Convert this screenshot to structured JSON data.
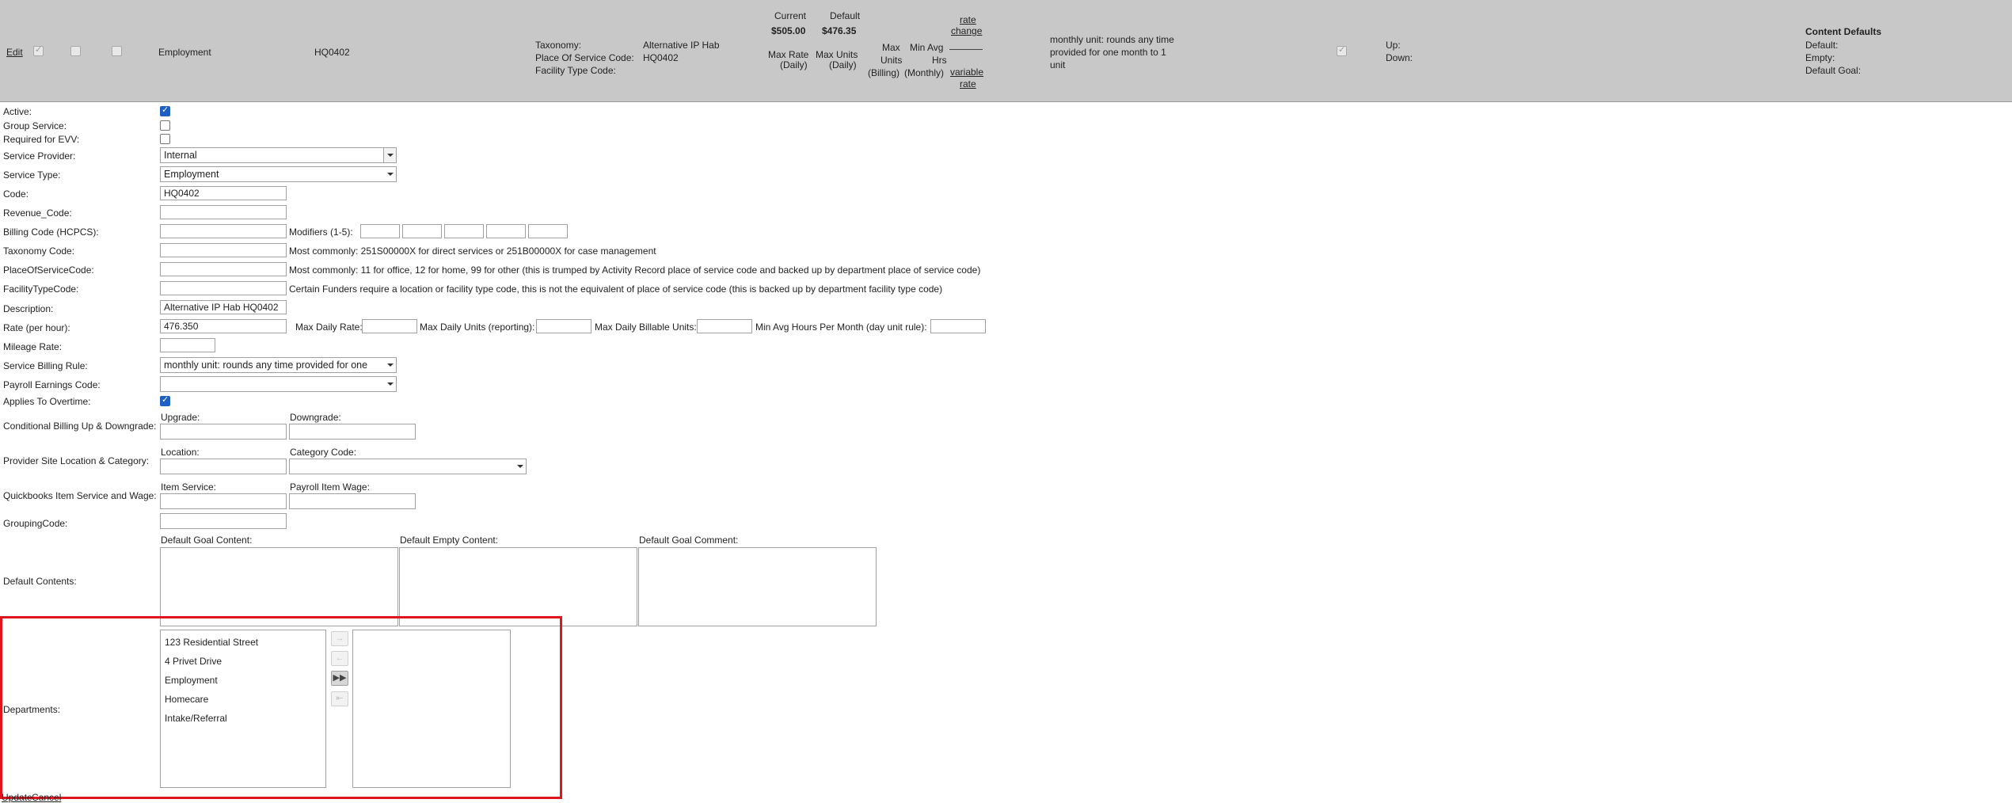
{
  "header": {
    "edit_link": "Edit",
    "service_name": "Employment",
    "code": "HQ0402",
    "taxonomy_label": "Taxonomy:",
    "pos_code_label": "Place Of Service Code:",
    "facility_type_label": "Facility Type Code:",
    "taxonomy_value": "Alternative IP Hab",
    "pos_value": "HQ0402",
    "current_label": "Current",
    "current_value": "$505.00",
    "default_label": "Default",
    "default_value": "$476.35",
    "max_rate_label_1": "Max Rate",
    "max_rate_label_2": "(Daily)",
    "max_units_daily_1": "Max Units",
    "max_units_daily_2": "(Daily)",
    "max_units_billing_1": "Max",
    "max_units_billing_2": "Units",
    "max_units_billing_3": "(Billing)",
    "min_avg_1": "Min Avg",
    "min_avg_2": "Hrs",
    "min_avg_3": "(Monthly)",
    "rate_change_1": "rate",
    "rate_change_2": "change",
    "variable_rate_1": "variable",
    "variable_rate_2": "rate",
    "billing_rule_1": "monthly unit: rounds any time",
    "billing_rule_2": "provided for one month to 1",
    "billing_rule_3": "unit",
    "up_label": "Up:",
    "down_label": "Down:",
    "content_defaults_title": "Content Defaults",
    "cd_default": "Default:",
    "cd_empty": "Empty:",
    "cd_goal": "Default Goal:"
  },
  "form": {
    "active": "Active:",
    "group_service": "Group Service:",
    "required_evv": "Required for EVV:",
    "service_provider": "Service Provider:",
    "service_provider_value": "Internal",
    "service_type": "Service Type:",
    "service_type_value": "Employment",
    "code": "Code:",
    "code_value": "HQ0402",
    "revenue_code": "Revenue_Code:",
    "billing_code": "Billing Code (HCPCS):",
    "modifiers": "Modifiers (1-5):",
    "taxonomy_code": "Taxonomy Code:",
    "taxonomy_hint": "Most commonly: 251S00000X for direct services or 251B00000X for case management",
    "pos_code": "PlaceOfServiceCode:",
    "pos_hint": "Most commonly: 11 for office, 12 for home, 99 for other (this is trumped by Activity Record place of service code and backed up by department place of service code)",
    "facility_type_code": "FacilityTypeCode:",
    "facility_hint": "Certain Funders require a location or facility type code, this is not the equivalent of place of service code (this is backed up by department facility type code)",
    "description": "Description:",
    "description_value": "Alternative IP Hab HQ0402",
    "rate": "Rate (per hour):",
    "rate_value": "476.350",
    "max_daily_rate": "Max Daily Rate:",
    "max_daily_units": "Max Daily Units (reporting):",
    "max_daily_billable": "Max Daily Billable Units:",
    "min_avg_hours": "Min Avg Hours Per Month (day unit rule):",
    "mileage_rate": "Mileage Rate:",
    "billing_rule": "Service Billing Rule:",
    "billing_rule_value": "monthly unit: rounds any time provided for one",
    "payroll_code": "Payroll Earnings Code:",
    "applies_overtime": "Applies To Overtime:",
    "cond_billing": "Conditional Billing Up & Downgrade:",
    "upgrade": "Upgrade:",
    "downgrade": "Downgrade:",
    "provider_site": "Provider Site Location & Category:",
    "location": "Location:",
    "category_code": "Category Code:",
    "quickbooks": "Quickbooks Item Service and Wage:",
    "item_service": "Item Service:",
    "payroll_item_wage": "Payroll Item Wage:",
    "grouping_code": "GroupingCode:",
    "default_contents": "Default Contents:",
    "default_goal_content": "Default Goal Content:",
    "default_empty_content": "Default Empty Content:",
    "default_goal_comment": "Default Goal Comment:",
    "departments": "Departments:",
    "departments_available": [
      "123 Residential Street",
      "4 Privet Drive",
      "Employment",
      "Homecare",
      "Intake/Referral"
    ],
    "update": "Update",
    "cancel": "Cancel"
  },
  "colors": {
    "header_bg": "#c8c8c8",
    "highlight": "#e0141c",
    "checkbox_on": "#1d5fc4"
  },
  "icons": [
    "checkmark-icon",
    "dropdown-arrow-icon",
    "move-right-icon",
    "move-left-icon",
    "move-all-right-icon",
    "move-all-left-icon"
  ]
}
